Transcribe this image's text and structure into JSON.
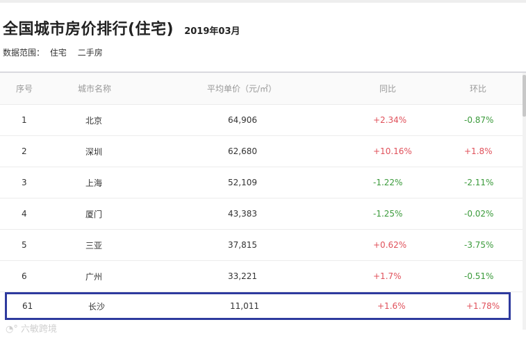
{
  "header": {
    "title": "全国城市房价排行(住宅)",
    "date": "2019年03月",
    "scope_label": "数据范围：",
    "scope_value_1": "住宅",
    "scope_value_2": "二手房"
  },
  "table": {
    "columns": [
      "序号",
      "城市名称",
      "平均单价（元/㎡）",
      "同比",
      "环比"
    ],
    "rows": [
      {
        "rank": "1",
        "city": "北京",
        "price": "64,906",
        "yoy": "+2.34%",
        "mom": "-0.87%"
      },
      {
        "rank": "2",
        "city": "深圳",
        "price": "62,680",
        "yoy": "+10.16%",
        "mom": "+1.8%"
      },
      {
        "rank": "3",
        "city": "上海",
        "price": "52,109",
        "yoy": "-1.22%",
        "mom": "-2.11%"
      },
      {
        "rank": "4",
        "city": "厦门",
        "price": "43,383",
        "yoy": "-1.25%",
        "mom": "-0.02%"
      },
      {
        "rank": "5",
        "city": "三亚",
        "price": "37,815",
        "yoy": "+0.62%",
        "mom": "-3.75%"
      },
      {
        "rank": "6",
        "city": "广州",
        "price": "33,221",
        "yoy": "+1.7%",
        "mom": "-0.51%"
      }
    ],
    "highlight": {
      "rank": "61",
      "city": "长沙",
      "price": "11,011",
      "yoy": "+1.6%",
      "mom": "+1.78%"
    }
  },
  "colors": {
    "increase": "#e0505a",
    "decrease": "#3a9a3a",
    "highlight_border": "#2e3a9e"
  },
  "watermark": "六敏跨境"
}
